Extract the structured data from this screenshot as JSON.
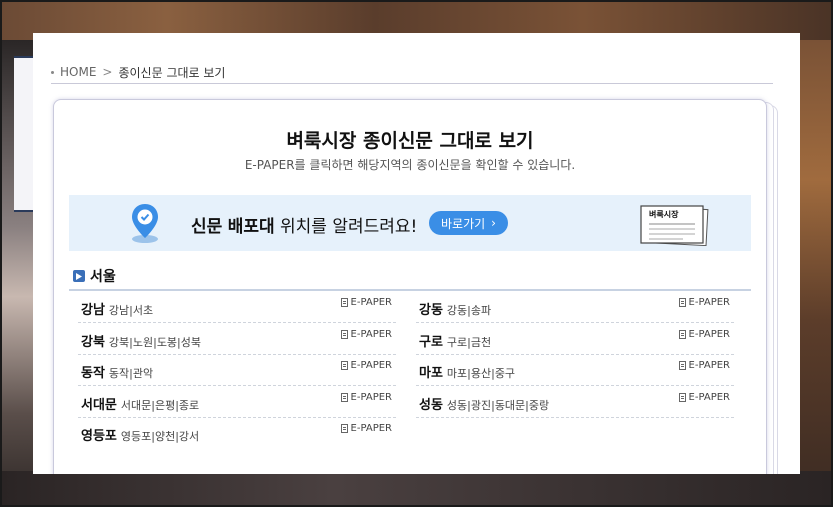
{
  "breadcrumb": {
    "home": "HOME",
    "separator": ">",
    "current": "종이신문 그대로 보기"
  },
  "header": {
    "title": "벼룩시장 종이신문 그대로 보기",
    "subtitle": "E-PAPER를 클릭하면 해당지역의 종이신문을 확인할 수 있습니다."
  },
  "banner": {
    "text_bold_1": "신문",
    "text_bold_2": "배포대",
    "text_rest": "위치를 알려드려요!",
    "button_label": "바로가기",
    "button_arrow": "›",
    "newspaper_label": "벼룩시장"
  },
  "region": {
    "label": "서울",
    "items": [
      {
        "name": "강남",
        "sub": "강남|서초",
        "ep": "E-PAPER"
      },
      {
        "name": "강동",
        "sub": "강동|송파",
        "ep": "E-PAPER"
      },
      {
        "name": "강북",
        "sub": "강북|노원|도봉|성북",
        "ep": "E-PAPER"
      },
      {
        "name": "구로",
        "sub": "구로|금천",
        "ep": "E-PAPER"
      },
      {
        "name": "동작",
        "sub": "동작|관악",
        "ep": "E-PAPER"
      },
      {
        "name": "마포",
        "sub": "마포|용산|중구",
        "ep": "E-PAPER"
      },
      {
        "name": "서대문",
        "sub": "서대문|은평|종로",
        "ep": "E-PAPER"
      },
      {
        "name": "성동",
        "sub": "성동|광진|동대문|중랑",
        "ep": "E-PAPER"
      },
      {
        "name": "영등포",
        "sub": "영등포|양천|강서",
        "ep": "E-PAPER"
      }
    ]
  },
  "colors": {
    "accent": "#3a8ee6",
    "banner_bg": "#e6f1fb",
    "region_icon": "#3a6fb8"
  }
}
